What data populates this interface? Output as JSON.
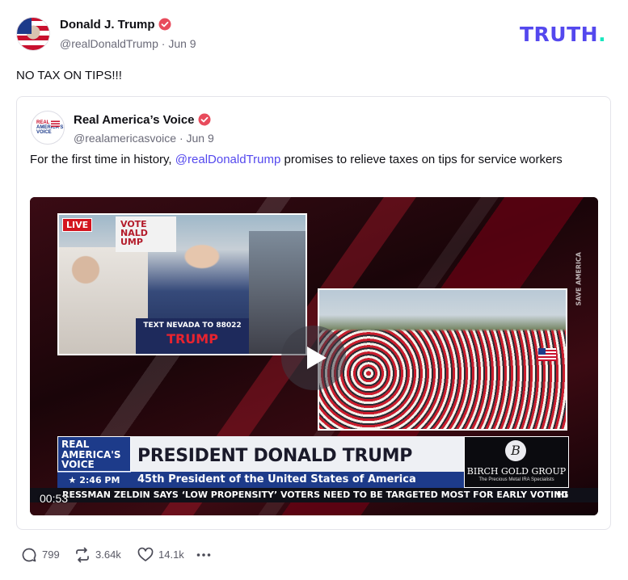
{
  "brand": {
    "logo_text": "TRUTH",
    "logo_dot": ".",
    "accent": "#5448ee",
    "accent2": "#17e7be"
  },
  "post": {
    "author_name": "Donald J. Trump",
    "handle": "@realDonaldTrump",
    "separator": "·",
    "date": "Jun 9",
    "text": "NO TAX ON TIPS!!!",
    "verified_icon": "verified-badge-icon"
  },
  "quote": {
    "author_name": "Real America’s Voice",
    "handle": "@realamericasvoice",
    "separator": "·",
    "date": "Jun 9",
    "text_before": "For the first time in history,",
    "mention": "@realDonaldTrump",
    "text_after": "promises to relieve taxes on tips for service workers",
    "avatar_lines": [
      "REAL",
      "AMERICA'S",
      "VOICE"
    ],
    "video": {
      "duration": "00:53",
      "live_badge": "LIVE",
      "sign_lines": [
        "VOTE",
        "NALD",
        "UMP"
      ],
      "podium_text": "TEXT NEVADA TO 88022",
      "podium_big": "TRUMP",
      "side_text": "SAVE AMERICA",
      "network_lines": [
        "REAL",
        "AMERICA'S",
        "VOICE"
      ],
      "time": "★ 2:46 PM CT★",
      "headline": "PRESIDENT DONALD TRUMP",
      "subheadline": "45th President of the United States of America",
      "ad_letter": "B",
      "ad_name": "BIRCH GOLD GROUP",
      "ad_tag": "The Precious Metal IRA Specialists",
      "ticker": "RESSMAN ZELDIN SAYS ‘LOW PROPENSITY’ VOTERS NEED TO BE TARGETED MOST FOR EARLY VOTING",
      "ticker_end": "HI"
    }
  },
  "actions": {
    "replies": "799",
    "reposts": "3.64k",
    "likes": "14.1k"
  }
}
